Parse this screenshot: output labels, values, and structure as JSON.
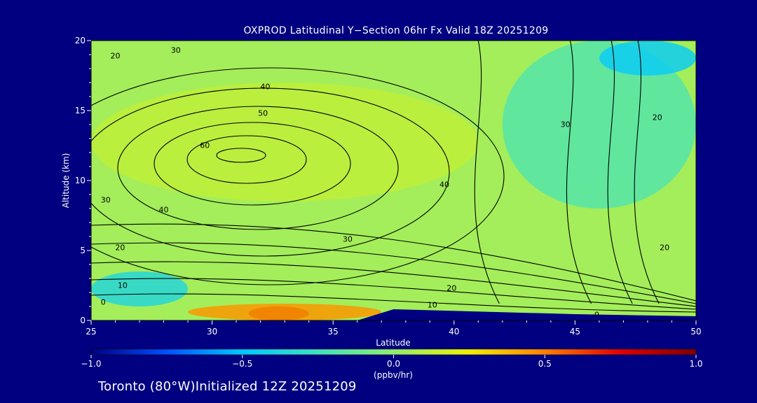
{
  "chart_data": {
    "type": "heatmap",
    "title": "OXPROD Latitudinal Y−Section 06hr  Fx Valid 18Z 20251209",
    "xlabel": "Latitude",
    "ylabel": "Altitude (km)",
    "xlim": [
      25,
      50
    ],
    "ylim": [
      0,
      20
    ],
    "xticks": [
      25,
      30,
      35,
      40,
      45,
      50
    ],
    "yticks": [
      0,
      5,
      10,
      15,
      20
    ],
    "colorbar": {
      "label": "(ppbv/hr)",
      "range": [
        -1.0,
        1.0
      ],
      "ticks": [
        -1.0,
        -0.5,
        0.0,
        0.5,
        1.0
      ],
      "tick_labels": [
        "−1.0",
        "−0.5",
        "0.0",
        "0.5",
        "1.0"
      ],
      "colormap": [
        "#000080",
        "#0050ff",
        "#00c8ff",
        "#40e0c0",
        "#90ee70",
        "#f0f000",
        "#ff8000",
        "#e00000",
        "#800000"
      ]
    },
    "contour_labels": [
      {
        "text": "20",
        "lat": 26.0,
        "alt": 18.9
      },
      {
        "text": "30",
        "lat": 28.5,
        "alt": 19.3
      },
      {
        "text": "40",
        "lat": 32.2,
        "alt": 16.7
      },
      {
        "text": "50",
        "lat": 32.1,
        "alt": 14.8
      },
      {
        "text": "60",
        "lat": 29.7,
        "alt": 12.5
      },
      {
        "text": "30",
        "lat": 25.6,
        "alt": 8.6
      },
      {
        "text": "40",
        "lat": 28.0,
        "alt": 7.9
      },
      {
        "text": "20",
        "lat": 26.2,
        "alt": 5.2
      },
      {
        "text": "10",
        "lat": 26.3,
        "alt": 2.5
      },
      {
        "text": "0",
        "lat": 25.5,
        "alt": 1.3
      },
      {
        "text": "30",
        "lat": 35.6,
        "alt": 5.8
      },
      {
        "text": "20",
        "lat": 39.9,
        "alt": 2.3
      },
      {
        "text": "10",
        "lat": 39.1,
        "alt": 1.1
      },
      {
        "text": "40",
        "lat": 39.6,
        "alt": 9.7
      },
      {
        "text": "30",
        "lat": 44.6,
        "alt": 14.0
      },
      {
        "text": "20",
        "lat": 48.4,
        "alt": 14.5
      },
      {
        "text": "20",
        "lat": 48.7,
        "alt": 5.2
      },
      {
        "text": "0",
        "lat": 45.9,
        "alt": 0.4
      }
    ],
    "field_regions": [
      {
        "name": "background",
        "value": 0.05
      },
      {
        "name": "upper-mid",
        "value": 0.12,
        "lat_range": [
          25,
          41
        ],
        "alt_range": [
          8.5,
          17
        ]
      },
      {
        "name": "high-lat-upper",
        "value": -0.18,
        "lat_range": [
          42,
          50
        ],
        "alt_range": [
          8,
          20
        ]
      },
      {
        "name": "top-right",
        "value": -0.45,
        "lat_range": [
          46,
          50
        ],
        "alt_range": [
          17.5,
          20
        ]
      },
      {
        "name": "low-lat-surface",
        "value": -0.35,
        "lat_range": [
          25,
          29
        ],
        "alt_range": [
          1,
          3.5
        ]
      },
      {
        "name": "surface-max",
        "value": 0.85,
        "lat_range": [
          31.5,
          34
        ],
        "alt_range": [
          0,
          1
        ]
      },
      {
        "name": "surface-pos",
        "value": 0.45,
        "lat_range": [
          29,
          37
        ],
        "alt_range": [
          0,
          1.2
        ]
      },
      {
        "name": "terrain",
        "value": -1.0,
        "lat_range": [
          36,
          50
        ],
        "alt_range": [
          0,
          0.8
        ]
      }
    ]
  },
  "footer": {
    "text": "Toronto (80°W)Initialized 12Z 20251209"
  }
}
